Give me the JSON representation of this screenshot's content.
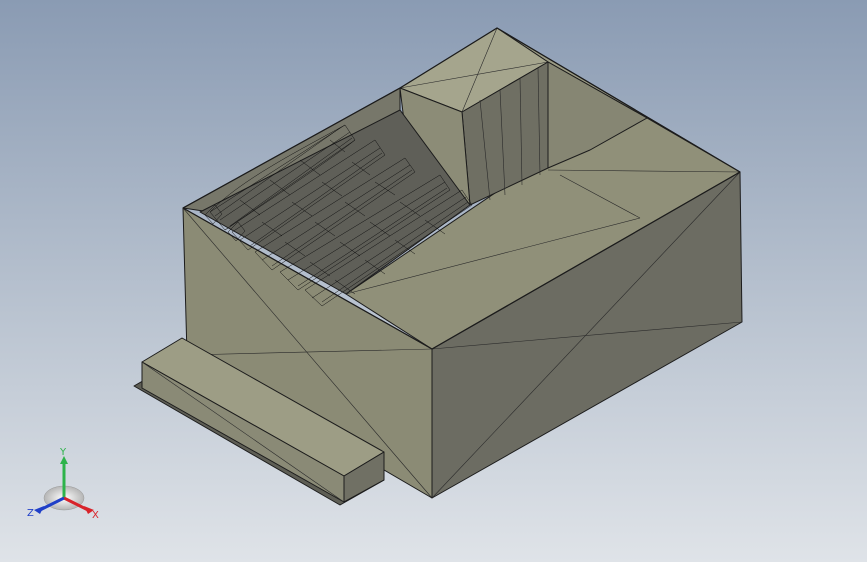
{
  "triad": {
    "x_label": "X",
    "y_label": "Y",
    "z_label": "Z",
    "x_color": "#d8232a",
    "y_color": "#2db34a",
    "z_color": "#1f3fc8",
    "x_icon": "x-axis-arrow-icon",
    "y_icon": "y-axis-arrow-icon",
    "z_icon": "z-axis-arrow-icon"
  },
  "scene": {
    "background_top": "#8a9bb3",
    "background_bottom": "#dfe3e8",
    "model_face_light": "#9d9d85",
    "model_face_mid": "#8a8a76",
    "model_face_dark": "#6f6f62",
    "edge_color": "#1c1c1c"
  }
}
